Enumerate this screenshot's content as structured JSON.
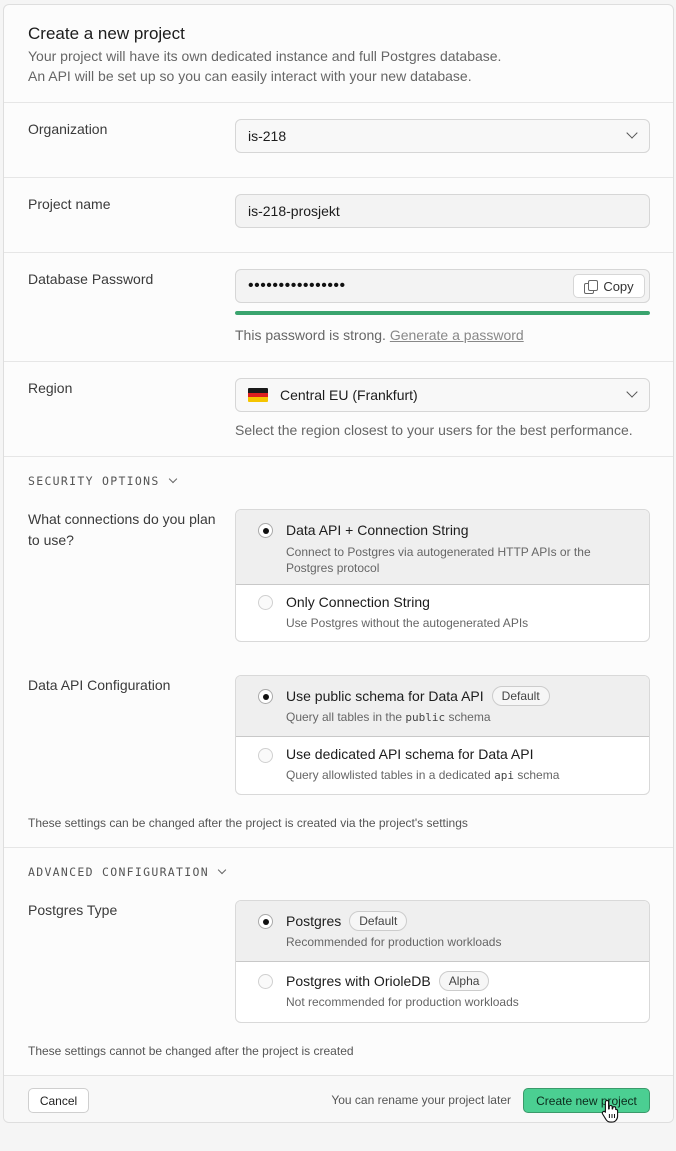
{
  "header": {
    "title": "Create a new project",
    "subtitle_line1": "Your project will have its own dedicated instance and full Postgres database.",
    "subtitle_line2": "An API will be set up so you can easily interact with your new database."
  },
  "organization": {
    "label": "Organization",
    "value": "is-218"
  },
  "project_name": {
    "label": "Project name",
    "value": "is-218-prosjekt"
  },
  "database_password": {
    "label": "Database Password",
    "masked_value": "••••••••••••••••",
    "copy_label": "Copy",
    "strength_fraction": 1.0,
    "strength_color": "#3aa46e",
    "strength_text": "This password is strong.",
    "generate_link": "Generate a password"
  },
  "region": {
    "label": "Region",
    "value": "Central EU (Frankfurt)",
    "flag_icon": "germany-flag-icon",
    "hint": "Select the region closest to your users for the best performance."
  },
  "security_options": {
    "heading": "SECURITY OPTIONS",
    "connections": {
      "label": "What connections do you plan to use?",
      "options": [
        {
          "title": "Data API + Connection String",
          "description": "Connect to Postgres via autogenerated HTTP APIs or the Postgres protocol",
          "selected": true
        },
        {
          "title": "Only Connection String",
          "description": "Use Postgres without the autogenerated APIs",
          "selected": false
        }
      ]
    },
    "data_api": {
      "label": "Data API Configuration",
      "options": [
        {
          "title": "Use public schema for Data API",
          "badge": "Default",
          "desc_before": "Query all tables in the",
          "desc_code": "public",
          "desc_after": "schema",
          "selected": true
        },
        {
          "title": "Use dedicated API schema for Data API",
          "desc_before": "Query allowlisted tables in a dedicated",
          "desc_code": "api",
          "desc_after": "schema",
          "selected": false
        }
      ]
    },
    "note": "These settings can be changed after the project is created via the project's settings"
  },
  "advanced_configuration": {
    "heading": "ADVANCED CONFIGURATION",
    "postgres_type": {
      "label": "Postgres Type",
      "options": [
        {
          "title": "Postgres",
          "badge": "Default",
          "description": "Recommended for production workloads",
          "selected": true
        },
        {
          "title": "Postgres with OrioleDB",
          "badge": "Alpha",
          "description": "Not recommended for production workloads",
          "selected": false
        }
      ]
    },
    "note": "These settings cannot be changed after the project is created"
  },
  "footer": {
    "cancel_label": "Cancel",
    "note": "You can rename your project later",
    "create_label": "Create new project",
    "accent_color": "#4bcf92"
  }
}
